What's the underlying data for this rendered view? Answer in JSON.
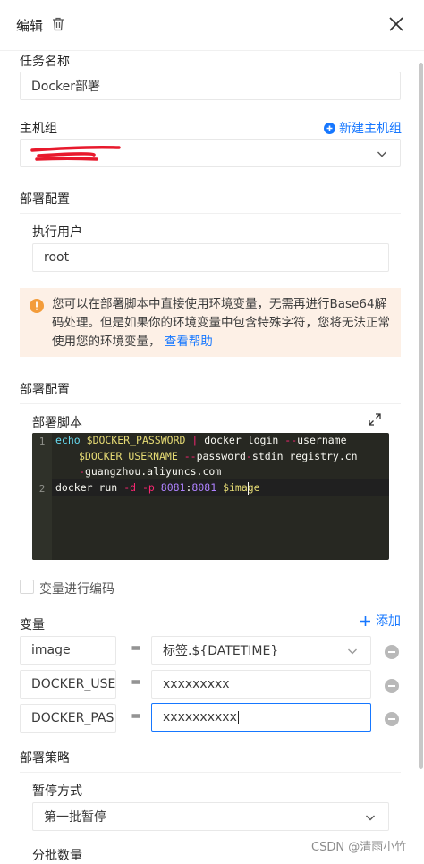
{
  "header": {
    "title": "编辑"
  },
  "task": {
    "label": "任务名称",
    "value": "Docker部署"
  },
  "host_group": {
    "label": "主机组",
    "new_link": "新建主机组"
  },
  "deploy_config": {
    "title": "部署配置",
    "user_label": "执行用户",
    "user_value": "root"
  },
  "alert": {
    "text": "您可以在部署脚本中直接使用环境变量，无需再进行Base64解码处理。但是如果你的环境变量中包含特殊字符，您将无法正常使用您的环境变量，",
    "link": "查看帮助"
  },
  "script_section": {
    "title": "部署配置",
    "script_label": "部署脚本",
    "line_numbers": [
      "1",
      "2"
    ]
  },
  "code": {
    "l1a_kw": "echo",
    "l1a_var": "$DOCKER_PASSWORD",
    "l1a_pipe": "|",
    "l1a_cmd": "docker login",
    "l1a_flag": "--",
    "l1a_opt": "username",
    "l1b_var": "$DOCKER_USERNAME",
    "l1b_flag": "--",
    "l1b_opt": "password",
    "l1b_dash": "-",
    "l1b_rest": "stdin registry.cn",
    "l1c_dash": "-",
    "l1c_rest": "guangzhou.aliyuncs.com",
    "l2_cmd": "docker run",
    "l2_d": "-d",
    "l2_p": "-p",
    "l2_port": "8081",
    "l2_colon": ":",
    "l2_port2": "8081",
    "l2_var": "$image"
  },
  "encode": {
    "label": "变量进行编码"
  },
  "variables": {
    "label": "变量",
    "add": "添加",
    "rows": [
      {
        "key": "image",
        "eq": "=",
        "value": "标签.${DATETIME}"
      },
      {
        "key": "DOCKER_USEI",
        "eq": "=",
        "value": "xxxxxxxxx"
      },
      {
        "key": "DOCKER_PAS!",
        "eq": "=",
        "value": "xxxxxxxxxx"
      }
    ]
  },
  "strategy": {
    "title": "部署策略",
    "pause_label": "暂停方式",
    "pause_value": "第一批暂停",
    "batch_label": "分批数量"
  },
  "watermark": "CSDN @清雨小竹",
  "colors": {
    "accent": "#1677ff",
    "warning": "#f39c3a",
    "redline": "#e8192c"
  }
}
